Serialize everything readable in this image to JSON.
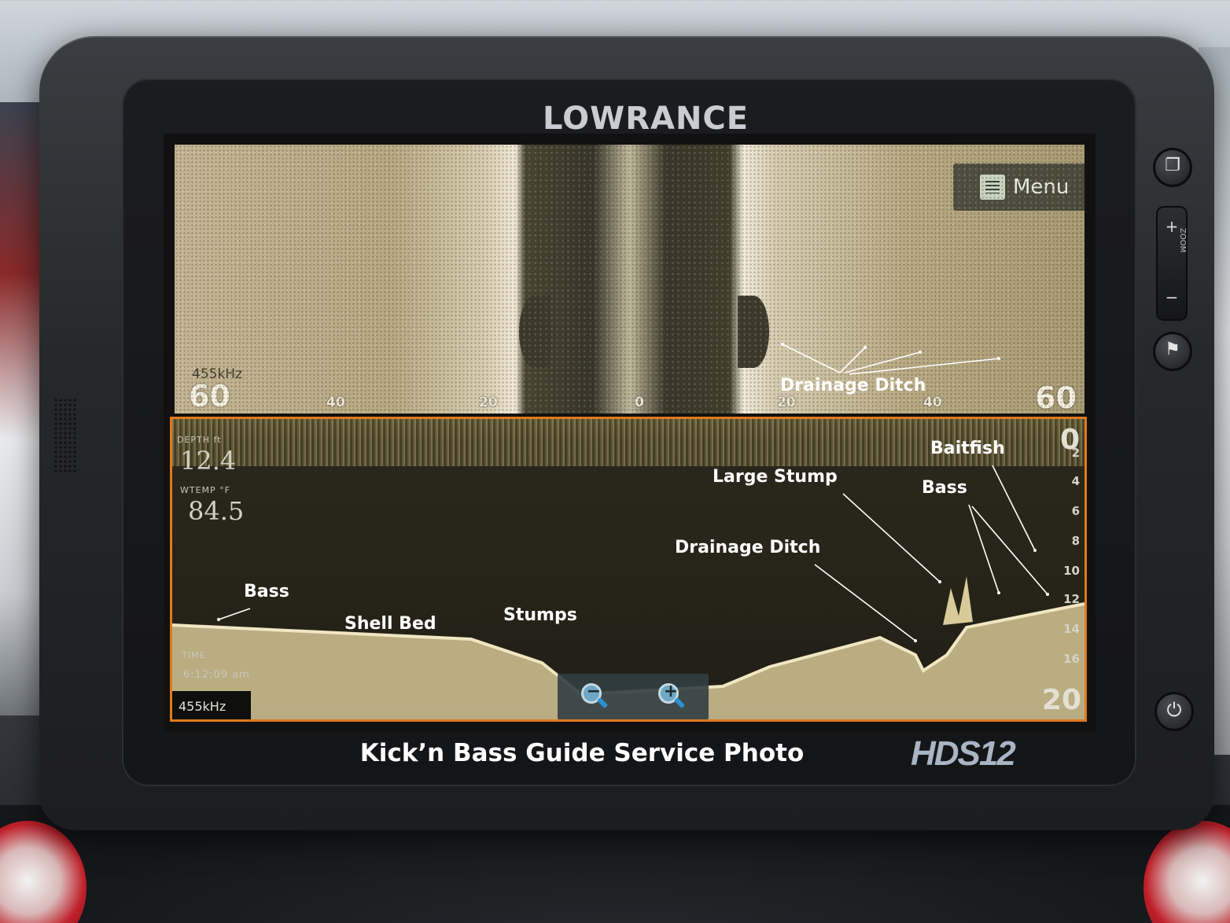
{
  "device": {
    "brand": "LOWRANCE",
    "model": "HDS12"
  },
  "caption": "Kick’n Bass Guide Service Photo",
  "sidescan": {
    "menu_label": "Menu",
    "frequency": "455kHz",
    "range_left": "60",
    "range_right": "60",
    "ticks": [
      "40",
      "20",
      "0",
      "20",
      "40"
    ]
  },
  "sonar": {
    "depth_label": "DEPTH ft",
    "depth_value": "12.4",
    "temp_label": "WTEMP °F",
    "temp_value": "84.5",
    "time_label": "TIME",
    "time_value": "6:12:09 am",
    "frequency": "455kHz",
    "depth_scale_top": "0",
    "depth_scale": [
      "2",
      "4",
      "6",
      "8",
      "10",
      "12",
      "14",
      "16"
    ],
    "depth_scale_bottom": "20"
  },
  "annotations": {
    "drainage_ditch_side": "Drainage Ditch",
    "baitfish": "Baitfish",
    "large_stump": "Large Stump",
    "bass_right": "Bass",
    "drainage_ditch_down": "Drainage Ditch",
    "bass_left": "Bass",
    "shell_bed": "Shell Bed",
    "stumps": "Stumps"
  },
  "buttons": {
    "zoom_out_symbol": "−",
    "zoom_in_symbol": "+",
    "rocker_plus": "+",
    "rocker_minus": "−",
    "rocker_label": "ZOOM"
  },
  "icons": [
    "menu-icon",
    "zoom-out-icon",
    "zoom-in-icon",
    "pages-icon",
    "waypoint-flag-icon",
    "power-icon"
  ]
}
